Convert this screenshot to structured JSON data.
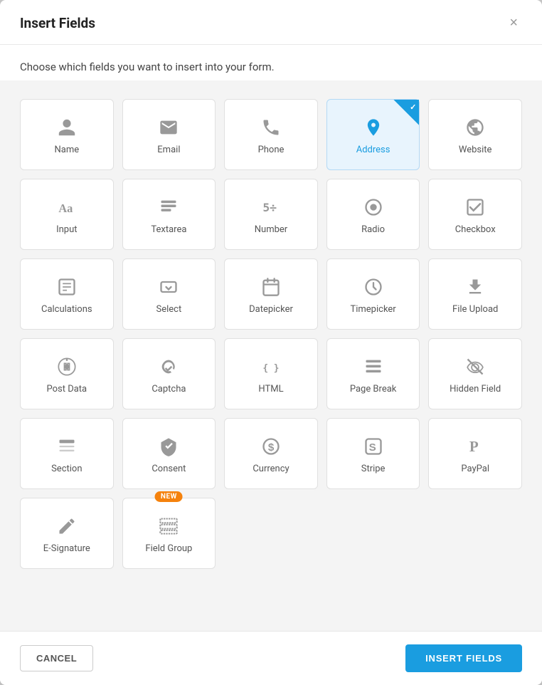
{
  "modal": {
    "title": "Insert Fields",
    "subtitle": "Choose which fields you want to insert into your form.",
    "close_label": "×"
  },
  "footer": {
    "cancel_label": "CANCEL",
    "insert_label": "INSERT FIELDS"
  },
  "fields": [
    {
      "id": "name",
      "label": "Name",
      "icon": "person",
      "selected": false
    },
    {
      "id": "email",
      "label": "Email",
      "icon": "email",
      "selected": false
    },
    {
      "id": "phone",
      "label": "Phone",
      "icon": "phone",
      "selected": false
    },
    {
      "id": "address",
      "label": "Address",
      "icon": "address",
      "selected": true
    },
    {
      "id": "website",
      "label": "Website",
      "icon": "website",
      "selected": false
    },
    {
      "id": "input",
      "label": "Input",
      "icon": "input",
      "selected": false
    },
    {
      "id": "textarea",
      "label": "Textarea",
      "icon": "textarea",
      "selected": false
    },
    {
      "id": "number",
      "label": "Number",
      "icon": "number",
      "selected": false
    },
    {
      "id": "radio",
      "label": "Radio",
      "icon": "radio",
      "selected": false
    },
    {
      "id": "checkbox",
      "label": "Checkbox",
      "icon": "checkbox",
      "selected": false
    },
    {
      "id": "calculations",
      "label": "Calculations",
      "icon": "calculations",
      "selected": false
    },
    {
      "id": "select",
      "label": "Select",
      "icon": "select",
      "selected": false
    },
    {
      "id": "datepicker",
      "label": "Datepicker",
      "icon": "datepicker",
      "selected": false
    },
    {
      "id": "timepicker",
      "label": "Timepicker",
      "icon": "timepicker",
      "selected": false
    },
    {
      "id": "fileupload",
      "label": "File Upload",
      "icon": "fileupload",
      "selected": false
    },
    {
      "id": "postdata",
      "label": "Post Data",
      "icon": "postdata",
      "selected": false
    },
    {
      "id": "captcha",
      "label": "Captcha",
      "icon": "captcha",
      "selected": false
    },
    {
      "id": "html",
      "label": "HTML",
      "icon": "html",
      "selected": false
    },
    {
      "id": "pagebreak",
      "label": "Page Break",
      "icon": "pagebreak",
      "selected": false
    },
    {
      "id": "hiddenfield",
      "label": "Hidden Field",
      "icon": "hiddenfield",
      "selected": false
    },
    {
      "id": "section",
      "label": "Section",
      "icon": "section",
      "selected": false
    },
    {
      "id": "consent",
      "label": "Consent",
      "icon": "consent",
      "selected": false
    },
    {
      "id": "currency",
      "label": "Currency",
      "icon": "currency",
      "selected": false
    },
    {
      "id": "stripe",
      "label": "Stripe",
      "icon": "stripe",
      "selected": false
    },
    {
      "id": "paypal",
      "label": "PayPal",
      "icon": "paypal",
      "selected": false
    },
    {
      "id": "esignature",
      "label": "E-Signature",
      "icon": "esignature",
      "selected": false
    },
    {
      "id": "fieldgroup",
      "label": "Field Group",
      "icon": "fieldgroup",
      "selected": false,
      "badge": "NEW"
    }
  ]
}
